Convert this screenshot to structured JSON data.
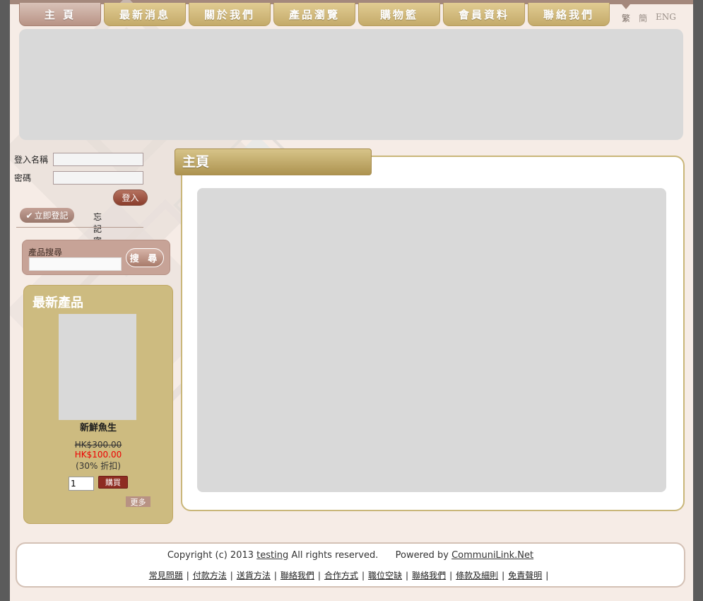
{
  "nav": {
    "tabs": [
      "主 頁",
      "最新消息",
      "關於我們",
      "產品瀏覽",
      "購物籃",
      "會員資料",
      "聯絡我們"
    ],
    "active_index": 0
  },
  "lang": {
    "trad": "繁",
    "simp": "簡",
    "eng": "ENG"
  },
  "login": {
    "username_label": "登入名稱",
    "password_label": "密碼",
    "login_button": "登入",
    "register_button": "立即登記",
    "forgot_link": "忘記密碼?"
  },
  "search": {
    "label": "產品搜尋",
    "button": "搜 尋"
  },
  "new_products": {
    "title": "最新產品",
    "product": {
      "name": "新鮮魚生",
      "old_price": "HK$300.00",
      "new_price": "HK$100.00",
      "discount": "(30% 折扣)",
      "quantity": "1",
      "buy_button": "購買"
    },
    "more_button": "更多"
  },
  "main": {
    "title": "主頁"
  },
  "footer": {
    "copyright_prefix": "Copyright (c) 2013",
    "copyright_link": "testing",
    "copyright_suffix": "All rights reserved.",
    "powered_prefix": "Powered by",
    "powered_link": "CommuniLink.Net",
    "links": [
      "常見問題",
      "付款方法",
      "送貨方法",
      "聯絡我們",
      "合作方式",
      "職位空缺",
      "聯絡我們",
      "條款及細則",
      "免責聲明"
    ]
  },
  "colors": {
    "nav_gold": "#c4aa6a",
    "nav_active": "#b89385",
    "page_bg": "#f6ece6",
    "price_red": "#e00000"
  }
}
